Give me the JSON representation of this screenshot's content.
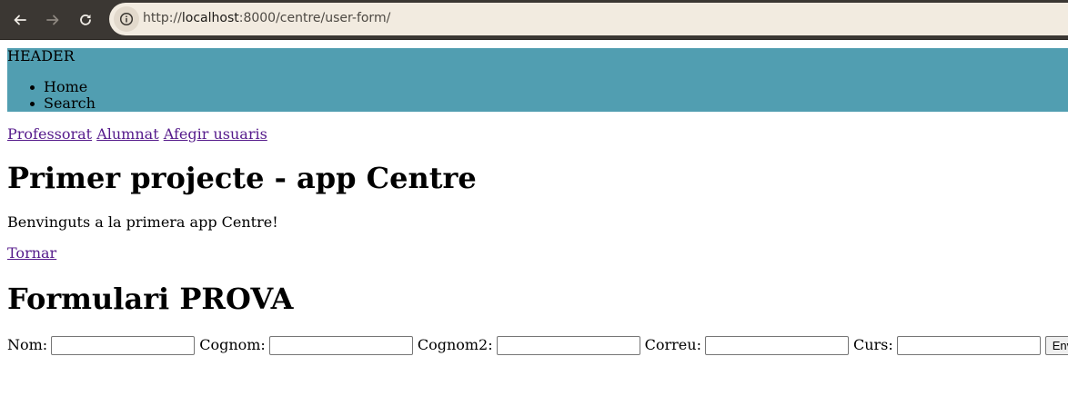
{
  "browser": {
    "url_scheme": "http://",
    "url_host": "localhost",
    "url_rest": ":8000/centre/user-form/",
    "back_icon": "arrow-left-icon",
    "forward_icon": "arrow-right-icon",
    "reload_icon": "reload-icon",
    "info_icon": "info-icon"
  },
  "header": {
    "title": "HEADER",
    "nav": [
      "Home",
      "Search"
    ],
    "background_color": "#519eb1"
  },
  "links": [
    "Professorat",
    "Alumnat",
    "Afegir usuaris"
  ],
  "main": {
    "title": "Primer projecte - app Centre",
    "welcome": "Benvinguts a la primera app Centre!",
    "back_link": "Tornar"
  },
  "form": {
    "title": "Formulari PROVA",
    "fields": [
      {
        "label": "Nom:",
        "value": ""
      },
      {
        "label": "Cognom:",
        "value": ""
      },
      {
        "label": "Cognom2:",
        "value": ""
      },
      {
        "label": "Correu:",
        "value": ""
      },
      {
        "label": "Curs:",
        "value": ""
      }
    ],
    "submit_label": "Enviar"
  }
}
